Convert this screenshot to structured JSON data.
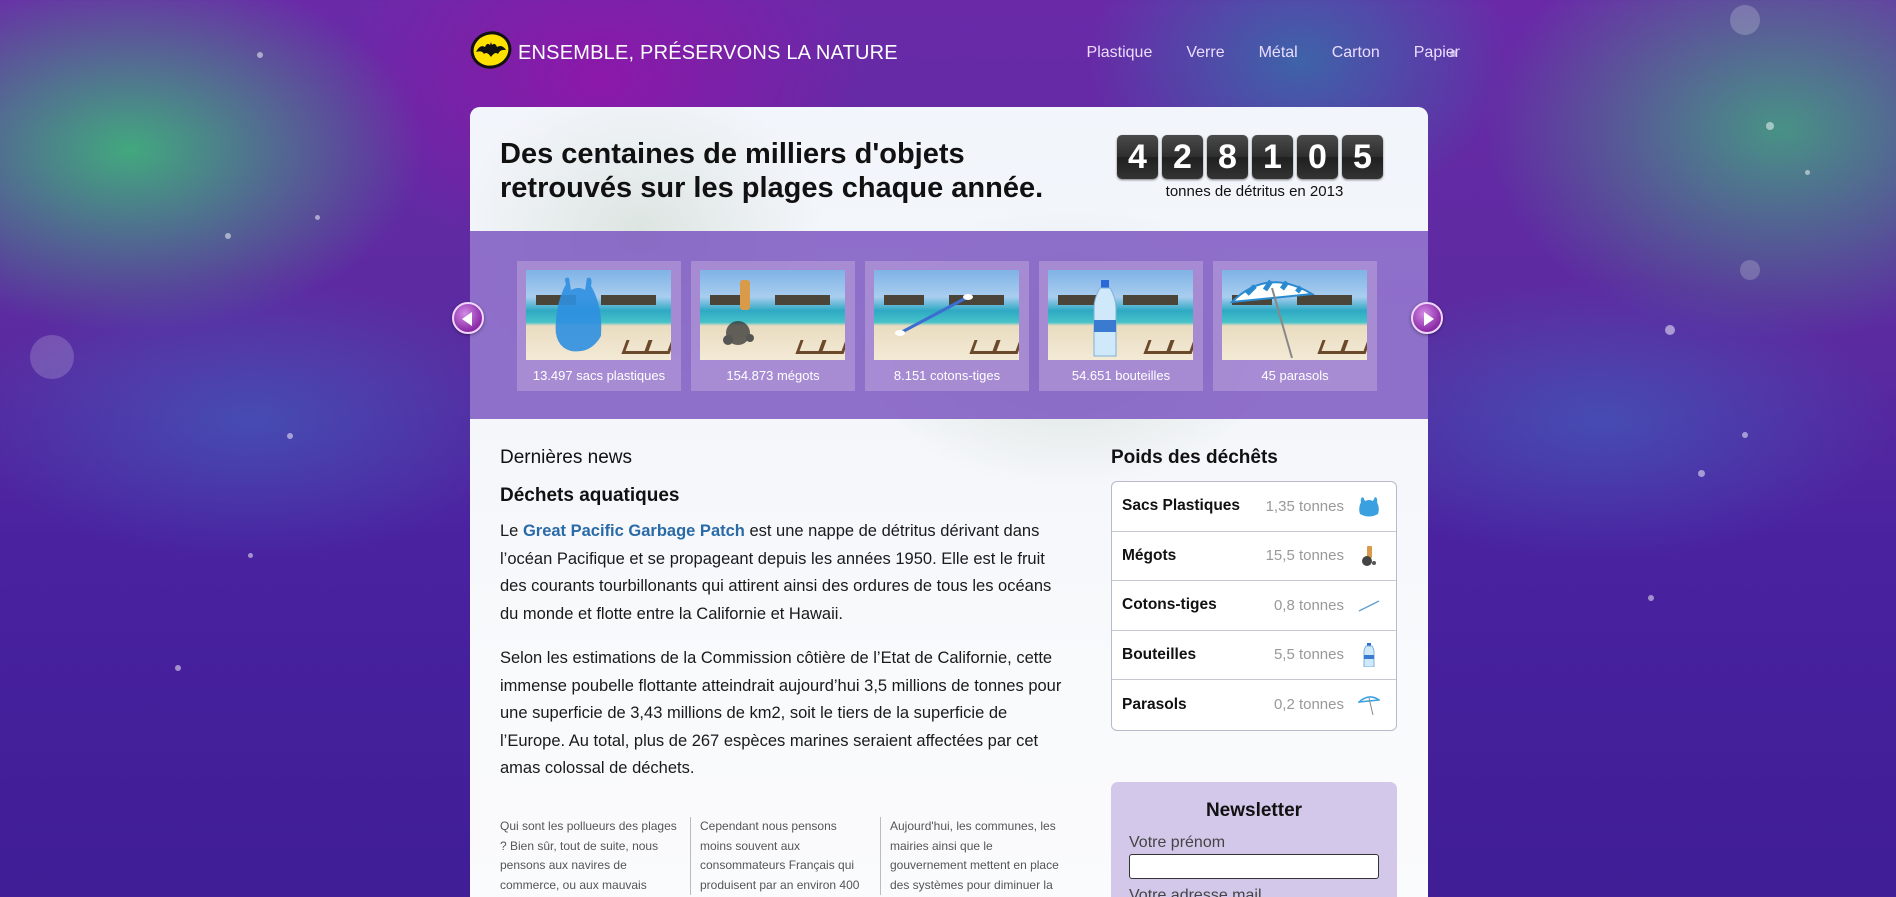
{
  "header": {
    "title": "ENSEMBLE, PRÉSERVONS LA NATURE",
    "nav": [
      "Plastique",
      "Verre",
      "Métal",
      "Carton",
      "Papier"
    ]
  },
  "hero": {
    "headline": "Des centaines de milliers d'objets retrouvés sur les plages chaque année.",
    "counter_digits": [
      "4",
      "2",
      "8",
      "1",
      "0",
      "5"
    ],
    "counter_caption": "tonnes de détritus en 2013"
  },
  "carousel": {
    "items": [
      {
        "label": "13.497 sacs plastiques",
        "object": "plastic-bag"
      },
      {
        "label": "154.873 mégots",
        "object": "cigarette-butt"
      },
      {
        "label": "8.151 cotons-tiges",
        "object": "cotton-swab"
      },
      {
        "label": "54.651 bouteilles",
        "object": "bottle"
      },
      {
        "label": "45 parasols",
        "object": "parasol"
      }
    ]
  },
  "news": {
    "heading": "Dernières news",
    "article_title": "Déchets aquatiques",
    "p1_prefix": "Le ",
    "p1_link": "Great Pacific Garbage Patch",
    "p1_rest": " est une nappe de détritus dérivant dans l’océan Pacifique et se propageant depuis les années 1950. Elle est le fruit des courants tourbillonants qui attirent ainsi des ordures de tous les océans du monde et flotte entre la Californie et Hawaii.",
    "p2": "Selon les estimations de la Commission côtière de l’Etat de Californie, cette immense poubelle flottante atteindrait aujourd’hui 3,5 millions de tonnes pour une superficie de 3,43 millions de km2, soit le tiers de la superficie de l’Europe. Au total, plus de 267 espèces marines seraient affectées par cet amas colossal de déchets.",
    "columns": [
      "Qui sont les pollueurs des plages ? Bien sûr, tout de suite, nous pensons aux navires de commerce, ou aux mauvais",
      "Cependant nous pensons moins souvent aux consommateurs Français qui produisent par an environ 400",
      "Aujourd'hui, les communes, les mairies ainsi que le gouvernement mettent en place des systèmes pour diminuer la"
    ]
  },
  "weights": {
    "title": "Poids des déchêts",
    "rows": [
      {
        "name": "Sacs Plastiques",
        "value": "1,35 tonnes",
        "icon": "plastic-bag-icon"
      },
      {
        "name": "Mégots",
        "value": "15,5 tonnes",
        "icon": "cigarette-butt-icon"
      },
      {
        "name": "Cotons-tiges",
        "value": "0,8 tonnes",
        "icon": "cotton-swab-icon"
      },
      {
        "name": "Bouteilles",
        "value": "5,5 tonnes",
        "icon": "bottle-icon"
      },
      {
        "name": "Parasols",
        "value": "0,2 tonnes",
        "icon": "parasol-icon"
      }
    ]
  },
  "newsletter": {
    "title": "Newsletter",
    "firstname_label": "Votre prénom",
    "firstname_value": "",
    "email_label": "Votre adresse mail"
  },
  "colors": {
    "link": "#2a6aa6",
    "band": "#7850be",
    "counter_bg": "#2e2e2e"
  }
}
